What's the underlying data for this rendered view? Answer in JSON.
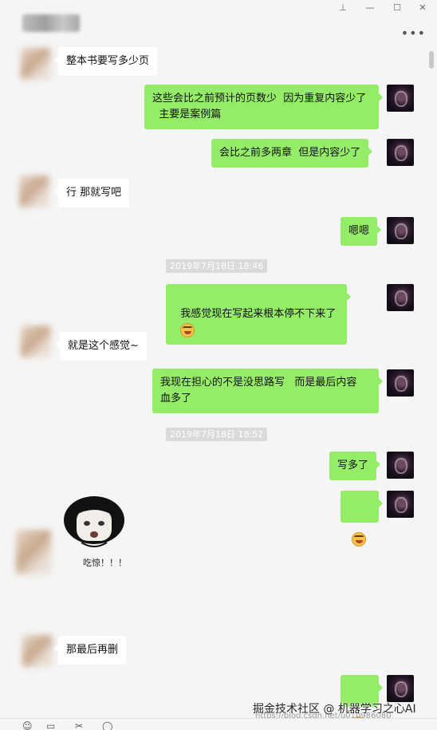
{
  "window": {
    "pin_glyph": "⊥",
    "minimize_glyph": "—",
    "maximize_glyph": "☐",
    "close_glyph": "✕",
    "more_glyph": "•••"
  },
  "messages": {
    "m1": "整本书要写多少页",
    "m2": "这些会比之前预计的页数少  因为重复内容少了\n  主要是案例篇",
    "m3": "会比之前多两章  但是内容少了",
    "m4": "行 那就写吧",
    "m5": "嗯嗯",
    "m6": "我感觉现在写起来根本停不下来了 ",
    "m7": "就是这个感觉~",
    "m8": "我现在担心的不是没思路写   而是最后内容\n血多了",
    "m9": "写多了",
    "m10": "那最后再删"
  },
  "timestamps": {
    "t1": "2019年7月18日 18:46",
    "t2": "2019年7月18日 18:52"
  },
  "sticker": {
    "caption": "吃惊！！！"
  },
  "toolbar": {
    "emoji_glyph": "☺",
    "folder_glyph": "▭",
    "scissors_glyph": "✂",
    "chat_glyph": "◯"
  },
  "watermark": {
    "text": "掘金技术社区 @ 机器学习之心AI",
    "url": "https://blog.csdn.net/u010986080"
  },
  "colors": {
    "self_bubble": "#95ec69",
    "other_bubble": "#ffffff",
    "background": "#f5f5f5"
  }
}
